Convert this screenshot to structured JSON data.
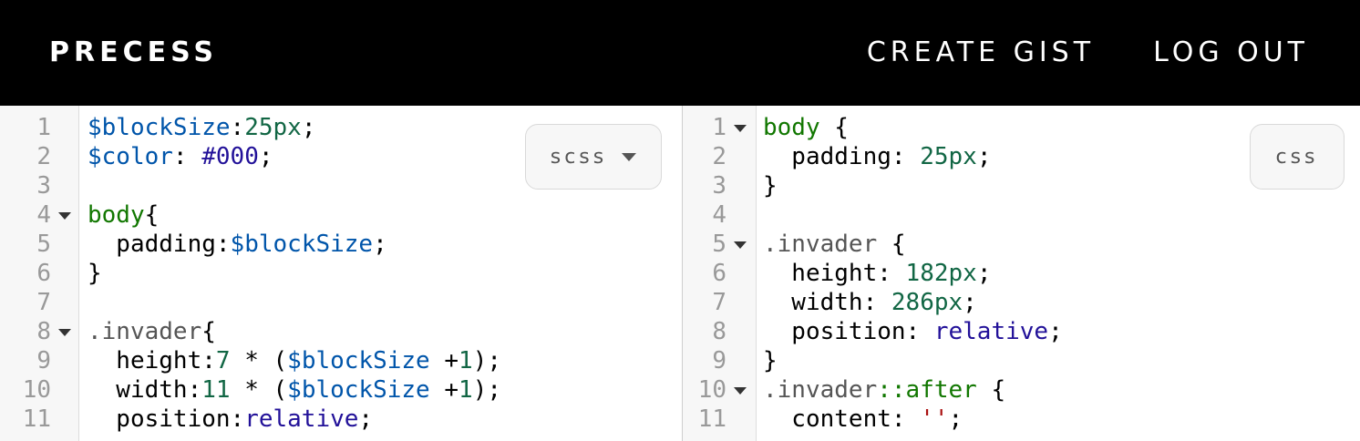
{
  "header": {
    "brand": "PRECESS",
    "nav": [
      {
        "label": "CREATE GIST"
      },
      {
        "label": "LOG OUT"
      }
    ]
  },
  "editor_left": {
    "language": "scss",
    "lines": [
      {
        "num": "1",
        "fold": false,
        "tokens": [
          {
            "t": "$blockSize",
            "c": "var"
          },
          {
            "t": ":",
            "c": ""
          },
          {
            "t": "25px",
            "c": "num"
          },
          {
            "t": ";",
            "c": ""
          }
        ]
      },
      {
        "num": "2",
        "fold": false,
        "tokens": [
          {
            "t": "$color",
            "c": "var"
          },
          {
            "t": ": ",
            "c": ""
          },
          {
            "t": "#000",
            "c": "atom"
          },
          {
            "t": ";",
            "c": ""
          }
        ]
      },
      {
        "num": "3",
        "fold": false,
        "tokens": []
      },
      {
        "num": "4",
        "fold": true,
        "tokens": [
          {
            "t": "body",
            "c": "tag"
          },
          {
            "t": "{",
            "c": ""
          }
        ]
      },
      {
        "num": "5",
        "fold": false,
        "tokens": [
          {
            "t": "  padding:",
            "c": ""
          },
          {
            "t": "$blockSize",
            "c": "var"
          },
          {
            "t": ";",
            "c": ""
          }
        ]
      },
      {
        "num": "6",
        "fold": false,
        "tokens": [
          {
            "t": "}",
            "c": ""
          }
        ]
      },
      {
        "num": "7",
        "fold": false,
        "tokens": []
      },
      {
        "num": "8",
        "fold": true,
        "tokens": [
          {
            "t": ".invader",
            "c": "qual"
          },
          {
            "t": "{",
            "c": ""
          }
        ]
      },
      {
        "num": "9",
        "fold": false,
        "tokens": [
          {
            "t": "  height:",
            "c": ""
          },
          {
            "t": "7",
            "c": "num"
          },
          {
            "t": " * (",
            "c": ""
          },
          {
            "t": "$blockSize",
            "c": "var"
          },
          {
            "t": " +",
            "c": ""
          },
          {
            "t": "1",
            "c": "num"
          },
          {
            "t": ");",
            "c": ""
          }
        ]
      },
      {
        "num": "10",
        "fold": false,
        "tokens": [
          {
            "t": "  width:",
            "c": ""
          },
          {
            "t": "11",
            "c": "num"
          },
          {
            "t": " * (",
            "c": ""
          },
          {
            "t": "$blockSize",
            "c": "var"
          },
          {
            "t": " +",
            "c": ""
          },
          {
            "t": "1",
            "c": "num"
          },
          {
            "t": ");",
            "c": ""
          }
        ]
      },
      {
        "num": "11",
        "fold": false,
        "tokens": [
          {
            "t": "  position:",
            "c": ""
          },
          {
            "t": "relative",
            "c": "atom"
          },
          {
            "t": ";",
            "c": ""
          }
        ]
      }
    ]
  },
  "editor_right": {
    "language": "css",
    "lines": [
      {
        "num": "1",
        "fold": true,
        "tokens": [
          {
            "t": "body",
            "c": "tag"
          },
          {
            "t": " {",
            "c": ""
          }
        ]
      },
      {
        "num": "2",
        "fold": false,
        "tokens": [
          {
            "t": "  padding: ",
            "c": ""
          },
          {
            "t": "25px",
            "c": "num"
          },
          {
            "t": ";",
            "c": ""
          }
        ]
      },
      {
        "num": "3",
        "fold": false,
        "tokens": [
          {
            "t": "}",
            "c": ""
          }
        ]
      },
      {
        "num": "4",
        "fold": false,
        "tokens": []
      },
      {
        "num": "5",
        "fold": true,
        "tokens": [
          {
            "t": ".invader",
            "c": "qual"
          },
          {
            "t": " {",
            "c": ""
          }
        ]
      },
      {
        "num": "6",
        "fold": false,
        "tokens": [
          {
            "t": "  height: ",
            "c": ""
          },
          {
            "t": "182px",
            "c": "num"
          },
          {
            "t": ";",
            "c": ""
          }
        ]
      },
      {
        "num": "7",
        "fold": false,
        "tokens": [
          {
            "t": "  width: ",
            "c": ""
          },
          {
            "t": "286px",
            "c": "num"
          },
          {
            "t": ";",
            "c": ""
          }
        ]
      },
      {
        "num": "8",
        "fold": false,
        "tokens": [
          {
            "t": "  position: ",
            "c": ""
          },
          {
            "t": "relative",
            "c": "atom"
          },
          {
            "t": ";",
            "c": ""
          }
        ]
      },
      {
        "num": "9",
        "fold": false,
        "tokens": [
          {
            "t": "}",
            "c": ""
          }
        ]
      },
      {
        "num": "10",
        "fold": true,
        "tokens": [
          {
            "t": ".invader",
            "c": "qual"
          },
          {
            "t": "::after",
            "c": "tag"
          },
          {
            "t": " {",
            "c": ""
          }
        ]
      },
      {
        "num": "11",
        "fold": false,
        "tokens": [
          {
            "t": "  content: ",
            "c": ""
          },
          {
            "t": "''",
            "c": "str"
          },
          {
            "t": ";",
            "c": ""
          }
        ]
      }
    ]
  },
  "colors": {
    "header_bg": "#000000",
    "variable": "#0055aa",
    "number": "#116644",
    "atom": "#221199",
    "tag": "#117700",
    "string": "#aa1111"
  },
  "icons": {
    "fold_marker": "triangle-down-icon",
    "dropdown": "chevron-down-icon"
  }
}
